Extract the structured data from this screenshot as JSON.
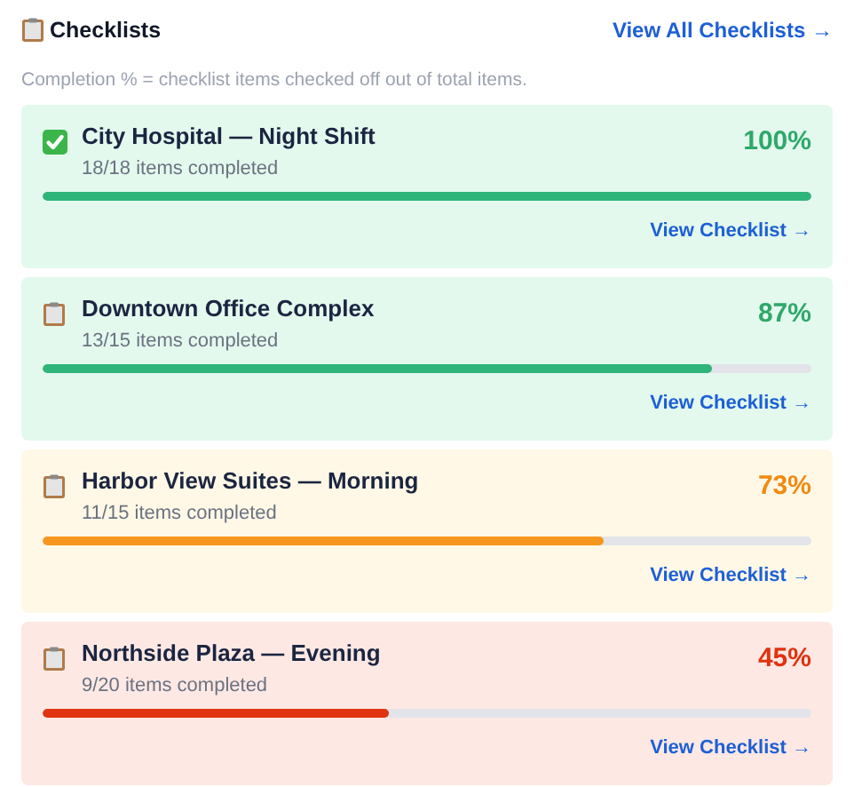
{
  "header": {
    "title": "Checklists",
    "link": "View All Checklists →"
  },
  "note": "Completion % = checklist items checked off out of total items.",
  "checklists": [
    {
      "name": "City Hospital — Night Shift",
      "summary": "18/18 items completed",
      "percent": "100%",
      "level": 1.0,
      "completed": true,
      "kind": "good",
      "link": "View Checklist →"
    },
    {
      "name": "Downtown Office Complex",
      "summary": "13/15 items completed",
      "percent": "87%",
      "level": 0.87,
      "completed": false,
      "kind": "good",
      "link": "View Checklist →"
    },
    {
      "name": "Harbor View Suites — Morning",
      "summary": "11/15 items completed",
      "percent": "73%",
      "level": 0.73,
      "completed": false,
      "kind": "warning",
      "link": "View Checklist →"
    },
    {
      "name": "Northside Plaza — Evening",
      "summary": "9/20 items completed",
      "percent": "45%",
      "level": 0.45,
      "completed": false,
      "kind": "danger",
      "link": "View Checklist →"
    }
  ]
}
